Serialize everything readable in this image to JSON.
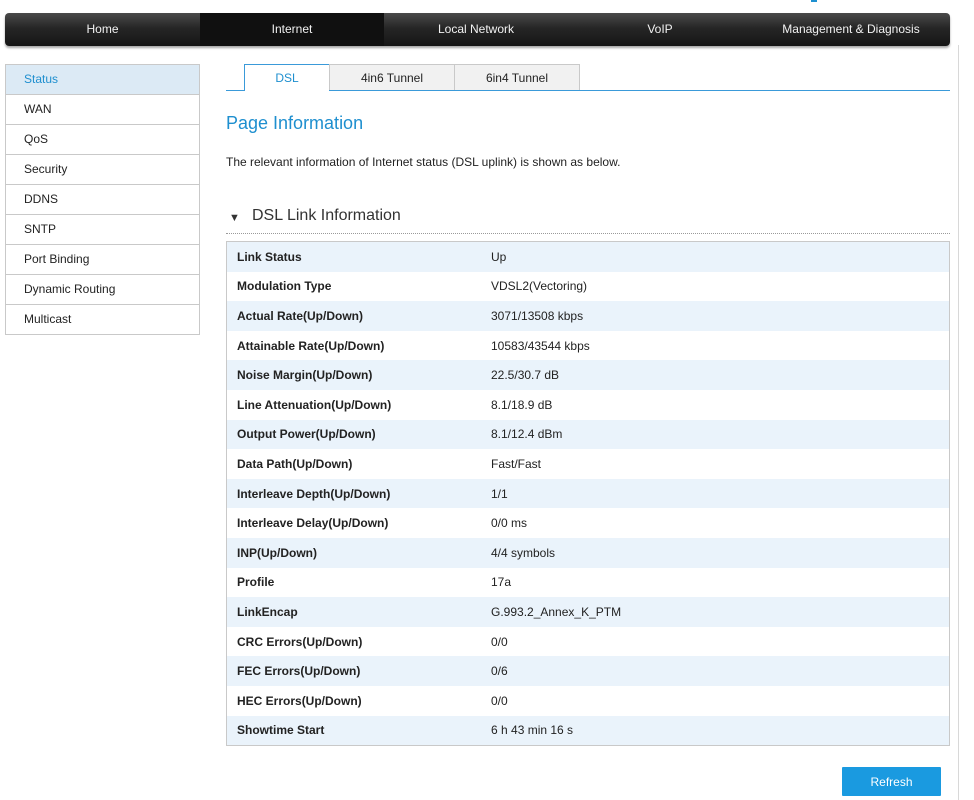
{
  "nav": {
    "items": [
      {
        "label": "Home",
        "active": false
      },
      {
        "label": "Internet",
        "active": true
      },
      {
        "label": "Local Network",
        "active": false
      },
      {
        "label": "VoIP",
        "active": false
      },
      {
        "label": "Management & Diagnosis",
        "active": false
      }
    ]
  },
  "sidebar": {
    "items": [
      {
        "label": "Status",
        "active": true
      },
      {
        "label": "WAN",
        "active": false
      },
      {
        "label": "QoS",
        "active": false
      },
      {
        "label": "Security",
        "active": false
      },
      {
        "label": "DDNS",
        "active": false
      },
      {
        "label": "SNTP",
        "active": false
      },
      {
        "label": "Port Binding",
        "active": false
      },
      {
        "label": "Dynamic Routing",
        "active": false
      },
      {
        "label": "Multicast",
        "active": false
      }
    ]
  },
  "tabs": [
    {
      "label": "DSL",
      "active": true
    },
    {
      "label": "4in6 Tunnel",
      "active": false
    },
    {
      "label": "6in4 Tunnel",
      "active": false
    }
  ],
  "page": {
    "title": "Page Information",
    "description": "The relevant information of Internet status (DSL uplink) is shown as below."
  },
  "section": {
    "title": "DSL Link Information",
    "rows": [
      {
        "label": "Link Status",
        "value": "Up"
      },
      {
        "label": "Modulation Type",
        "value": "VDSL2(Vectoring)"
      },
      {
        "label": "Actual Rate(Up/Down)",
        "value": "3071/13508 kbps"
      },
      {
        "label": "Attainable Rate(Up/Down)",
        "value": "10583/43544 kbps"
      },
      {
        "label": "Noise Margin(Up/Down)",
        "value": "22.5/30.7 dB"
      },
      {
        "label": "Line Attenuation(Up/Down)",
        "value": "8.1/18.9 dB"
      },
      {
        "label": "Output Power(Up/Down)",
        "value": "8.1/12.4 dBm"
      },
      {
        "label": "Data Path(Up/Down)",
        "value": "Fast/Fast"
      },
      {
        "label": "Interleave Depth(Up/Down)",
        "value": "1/1"
      },
      {
        "label": "Interleave Delay(Up/Down)",
        "value": "0/0 ms"
      },
      {
        "label": "INP(Up/Down)",
        "value": "4/4 symbols"
      },
      {
        "label": "Profile",
        "value": "17a"
      },
      {
        "label": "LinkEncap",
        "value": "G.993.2_Annex_K_PTM"
      },
      {
        "label": "CRC Errors(Up/Down)",
        "value": "0/0"
      },
      {
        "label": "FEC Errors(Up/Down)",
        "value": "0/6"
      },
      {
        "label": "HEC Errors(Up/Down)",
        "value": "0/0"
      },
      {
        "label": "Showtime Start",
        "value": "6 h 43 min 16 s"
      }
    ]
  },
  "actions": {
    "refresh_label": "Refresh"
  },
  "colors": {
    "accent": "#1e8fcf",
    "button": "#1a9ae0",
    "row_alt": "#eaf3fb",
    "nav_bg": "#262626"
  }
}
